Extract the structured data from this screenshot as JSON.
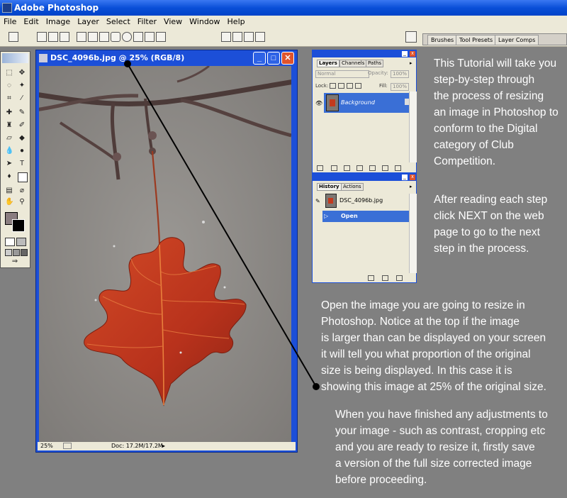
{
  "app": {
    "title": "Adobe Photoshop"
  },
  "menu": [
    "File",
    "Edit",
    "Image",
    "Layer",
    "Select",
    "Filter",
    "View",
    "Window",
    "Help"
  ],
  "palette_well": {
    "tabs": [
      "Brushes",
      "Tool Presets",
      "Layer Comps"
    ]
  },
  "document": {
    "title": "DSC_4096b.jpg @ 25% (RGB/8)",
    "zoom": "25%",
    "doc_info": "Doc: 17.2M/17.2M"
  },
  "layers_panel": {
    "tabs": [
      "Layers",
      "Channels",
      "Paths"
    ],
    "blend_mode": "Normal",
    "opacity_label": "Opacity:",
    "opacity_value": "100%",
    "lock_label": "Lock:",
    "fill_label": "Fill:",
    "fill_value": "100%",
    "layer_name": "Background"
  },
  "history_panel": {
    "tabs": [
      "History",
      "Actions"
    ],
    "snapshot_name": "DSC_4096b.jpg",
    "state_name": "Open"
  },
  "tutorial": {
    "intro": [
      "This Tutorial will take you",
      "step-by-step through",
      "the process of resizing",
      "an image in Photoshop to",
      "conform to the Digital",
      "category of Club",
      "Competition."
    ],
    "next": [
      "After reading each step",
      "click NEXT on the web",
      "page to go to the next",
      "step in the process."
    ],
    "open_note": [
      "Open the image you are going to resize in",
      "Photoshop.  Notice at the top if the image",
      "is larger than can be displayed on your screen",
      "it will tell you what proportion of the original",
      "size is being displayed.  In this case it is",
      "showing this image at 25% of the original size."
    ],
    "save_note": [
      "When you have finished any adjustments to",
      "your image - such as contrast, cropping etc",
      "and you are ready to resize it, firstly save",
      "a version of the full size corrected image",
      "before proceeding."
    ]
  },
  "colors": {
    "title_blue": "#0a4fd8",
    "panel_bg": "#ece9d8",
    "leaf": "#c33a1e",
    "layer_selected": "#3a6fd6"
  }
}
